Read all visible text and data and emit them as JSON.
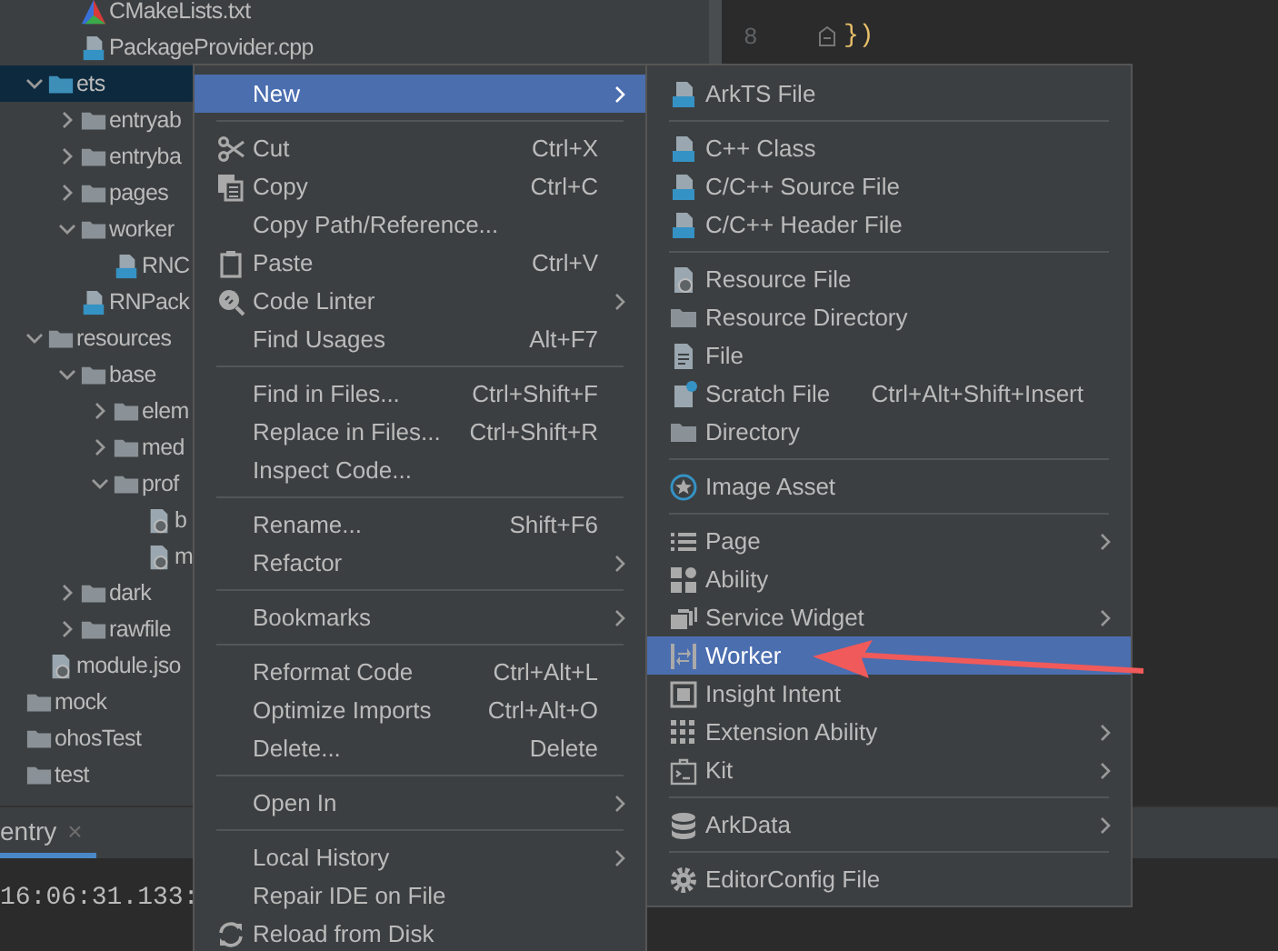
{
  "tree": [
    {
      "children": [
        {
          "children": [
            {
              "name": "CMakeLists.txt",
              "kind": "cmake",
              "selected": false
            },
            {
              "name": "PackageProvider.cpp",
              "kind": "cpp",
              "selected": false
            }
          ]
        },
        {
          "name": "ets",
          "kind": "source-folder",
          "expanded": true,
          "selected": true,
          "children": [
            {
              "name": "entryab",
              "kind": "folder",
              "expanded": false,
              "selected": false
            },
            {
              "name": "entryba",
              "kind": "folder",
              "expanded": false,
              "selected": false
            },
            {
              "name": "pages",
              "kind": "folder",
              "expanded": false,
              "selected": false
            },
            {
              "name": "worker",
              "kind": "folder",
              "expanded": true,
              "selected": false,
              "children": [
                {
                  "name": "RNC",
                  "kind": "ets",
                  "selected": false
                }
              ]
            },
            {
              "name": "RNPack",
              "kind": "ets",
              "selected": false
            }
          ]
        },
        {
          "name": "resources",
          "kind": "folder",
          "expanded": true,
          "selected": false,
          "children": [
            {
              "name": "base",
              "kind": "folder",
              "expanded": true,
              "selected": false,
              "children": [
                {
                  "name": "elem",
                  "kind": "folder",
                  "expanded": false,
                  "selected": false
                },
                {
                  "name": "med",
                  "kind": "folder",
                  "expanded": false,
                  "selected": false
                },
                {
                  "name": "prof",
                  "kind": "folder",
                  "expanded": true,
                  "selected": false,
                  "children": [
                    {
                      "name": "b",
                      "kind": "json",
                      "selected": false
                    },
                    {
                      "name": "m",
                      "kind": "json",
                      "selected": false
                    }
                  ]
                }
              ]
            },
            {
              "name": "dark",
              "kind": "folder",
              "expanded": false,
              "selected": false
            },
            {
              "name": "rawfile",
              "kind": "folder",
              "expanded": false,
              "selected": false
            }
          ]
        },
        {
          "name": "module.jso",
          "kind": "json",
          "selected": false
        }
      ]
    },
    {
      "name": "mock",
      "kind": "folder",
      "selected": false
    },
    {
      "name": "ohosTest",
      "kind": "folder",
      "selected": false
    },
    {
      "name": "test",
      "kind": "folder",
      "selected": false
    }
  ],
  "editor": {
    "line_number": "8",
    "code": "})"
  },
  "bottom_panel": {
    "tab": {
      "label": "entry",
      "close": "×",
      "selected": true
    },
    "console_line": "16:06:31.133:"
  },
  "context_menu": {
    "groups": [
      {
        "items": [
          {
            "label": "New",
            "submenu": true,
            "selected": true
          }
        ]
      },
      {
        "items": [
          {
            "label": "Cut",
            "shortcut": "Ctrl+X",
            "kind": "scissors",
            "submenu": false,
            "selected": false
          },
          {
            "label": "Copy",
            "shortcut": "Ctrl+C",
            "kind": "copy",
            "submenu": false,
            "selected": false
          },
          {
            "label": "Copy Path/Reference...",
            "submenu": false,
            "selected": false
          },
          {
            "label": "Paste",
            "shortcut": "Ctrl+V",
            "kind": "paste",
            "submenu": false,
            "selected": false
          },
          {
            "label": "Code Linter",
            "kind": "linter",
            "submenu": true,
            "selected": false
          },
          {
            "label": "Find Usages",
            "shortcut": "Alt+F7",
            "submenu": false,
            "selected": false
          }
        ]
      },
      {
        "items": [
          {
            "label": "Find in Files...",
            "shortcut": "Ctrl+Shift+F",
            "submenu": false,
            "selected": false
          },
          {
            "label": "Replace in Files...",
            "shortcut": "Ctrl+Shift+R",
            "submenu": false,
            "selected": false
          },
          {
            "label": "Inspect Code...",
            "submenu": false,
            "selected": false
          }
        ]
      },
      {
        "items": [
          {
            "label": "Rename...",
            "shortcut": "Shift+F6",
            "submenu": false,
            "selected": false
          },
          {
            "label": "Refactor",
            "submenu": true,
            "selected": false
          }
        ]
      },
      {
        "items": [
          {
            "label": "Bookmarks",
            "submenu": true,
            "selected": false
          }
        ]
      },
      {
        "items": [
          {
            "label": "Reformat Code",
            "shortcut": "Ctrl+Alt+L",
            "submenu": false,
            "selected": false
          },
          {
            "label": "Optimize Imports",
            "shortcut": "Ctrl+Alt+O",
            "submenu": false,
            "selected": false
          },
          {
            "label": "Delete...",
            "shortcut": "Delete",
            "submenu": false,
            "selected": false
          }
        ]
      },
      {
        "items": [
          {
            "label": "Open In",
            "submenu": true,
            "selected": false
          }
        ]
      },
      {
        "items": [
          {
            "label": "Local History",
            "submenu": true,
            "selected": false
          },
          {
            "label": "Repair IDE on File",
            "submenu": false,
            "selected": false
          },
          {
            "label": "Reload from Disk",
            "kind": "reload",
            "submenu": false,
            "selected": false
          }
        ]
      }
    ]
  },
  "new_submenu": {
    "groups": [
      {
        "items": [
          {
            "label": "ArkTS File",
            "kind": "ets",
            "submenu": false,
            "selected": false
          }
        ]
      },
      {
        "items": [
          {
            "label": "C++ Class",
            "kind": "cpp",
            "submenu": false,
            "selected": false
          },
          {
            "label": "C/C++ Source File",
            "kind": "c",
            "submenu": false,
            "selected": false
          },
          {
            "label": "C/C++ Header File",
            "kind": "h",
            "submenu": false,
            "selected": false
          }
        ]
      },
      {
        "items": [
          {
            "label": "Resource File",
            "kind": "json",
            "submenu": false,
            "selected": false
          },
          {
            "label": "Resource Directory",
            "kind": "folder",
            "submenu": false,
            "selected": false
          },
          {
            "label": "File",
            "kind": "file",
            "submenu": false,
            "selected": false
          },
          {
            "label": "Scratch File",
            "shortcut": "Ctrl+Alt+Shift+Insert",
            "kind": "scratch",
            "submenu": false,
            "selected": false
          },
          {
            "label": "Directory",
            "kind": "folder",
            "submenu": false,
            "selected": false
          }
        ]
      },
      {
        "items": [
          {
            "label": "Image Asset",
            "kind": "star",
            "submenu": false,
            "selected": false
          }
        ]
      },
      {
        "items": [
          {
            "label": "Page",
            "kind": "list",
            "submenu": true,
            "selected": false
          },
          {
            "label": "Ability",
            "kind": "grid",
            "submenu": false,
            "selected": false
          },
          {
            "label": "Service Widget",
            "kind": "layers",
            "submenu": true,
            "selected": false
          },
          {
            "label": "Worker",
            "kind": "swap",
            "submenu": false,
            "selected": true
          },
          {
            "label": "Insight Intent",
            "kind": "cube",
            "submenu": false,
            "selected": false
          },
          {
            "label": "Extension Ability",
            "kind": "dots",
            "submenu": true,
            "selected": false
          },
          {
            "label": "Kit",
            "kind": "terminal",
            "submenu": true,
            "selected": false
          }
        ]
      },
      {
        "items": [
          {
            "label": "ArkData",
            "kind": "database",
            "submenu": true,
            "selected": false
          }
        ]
      },
      {
        "items": [
          {
            "label": "EditorConfig File",
            "kind": "gear",
            "submenu": false,
            "selected": false
          }
        ]
      }
    ]
  }
}
